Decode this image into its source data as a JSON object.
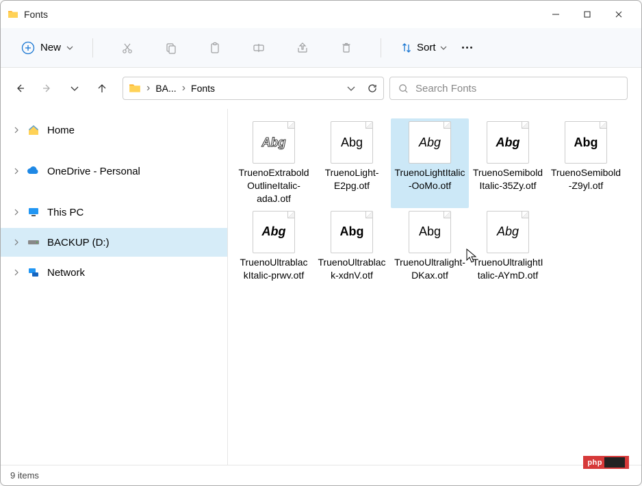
{
  "window": {
    "title": "Fonts"
  },
  "toolbar": {
    "new_label": "New",
    "sort_label": "Sort"
  },
  "breadcrumbs": {
    "seg0": "BA...",
    "seg1": "Fonts"
  },
  "search": {
    "placeholder": "Search Fonts"
  },
  "sidebar": {
    "items": [
      {
        "label": "Home",
        "icon": "home",
        "selected": false
      },
      {
        "label": "OneDrive - Personal",
        "icon": "onedrive",
        "selected": false
      },
      {
        "label": "This PC",
        "icon": "thispc",
        "selected": false
      },
      {
        "label": "BACKUP (D:)",
        "icon": "drive",
        "selected": true
      },
      {
        "label": "Network",
        "icon": "network",
        "selected": false
      }
    ]
  },
  "files": [
    {
      "name": "TruenoExtraboldOutlineItalic-adaJ.otf",
      "style": "outline-italic",
      "selected": false
    },
    {
      "name": "TruenoLight-E2pg.otf",
      "style": "light",
      "selected": false
    },
    {
      "name": "TruenoLightItalic-OoMo.otf",
      "style": "light-italic",
      "selected": true
    },
    {
      "name": "TruenoSemiboldItalic-35Zy.otf",
      "style": "bold-italic",
      "selected": false
    },
    {
      "name": "TruenoSemibold-Z9yl.otf",
      "style": "bold",
      "selected": false
    },
    {
      "name": "TruenoUltrablackItalic-prwv.otf",
      "style": "black-italic",
      "selected": false
    },
    {
      "name": "TruenoUltrablack-xdnV.otf",
      "style": "black",
      "selected": false
    },
    {
      "name": "TruenoUltralight-DKax.otf",
      "style": "ultralight",
      "selected": false
    },
    {
      "name": "TruenoUltralightItalic-AYmD.otf",
      "style": "ultralight-italic",
      "selected": false
    }
  ],
  "status": {
    "items_text": "9 items"
  },
  "badge": {
    "text": "php"
  }
}
